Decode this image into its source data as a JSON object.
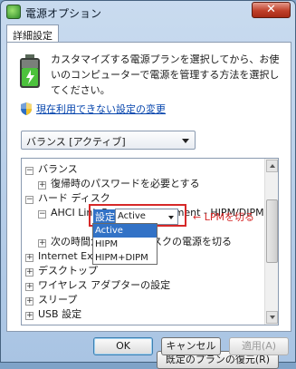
{
  "window": {
    "title": "電源オプション",
    "close_glyph": "✕"
  },
  "tabs": [
    {
      "label": "詳細設定"
    }
  ],
  "description": "カスタマイズする電源プランを選択してから、お使いのコンピューターで電源を管理する方法を選択してください。",
  "link_text": "現在利用できない設定の変更",
  "plan_select": {
    "value": "バランス [アクティブ]"
  },
  "tree": {
    "balance": "バランス",
    "wake_password": "復帰時のパスワードを必要とする",
    "hard_disk": "ハード ディスク",
    "ahci": "AHCI Link Power Management - HIPM/DIPM",
    "setting_label": "設定:",
    "setting_value": "Active",
    "next_time": "次の時間が",
    "next_time_tail": "ィスクの電源を切る",
    "internet": "Internet Exp",
    "desktop": "デスクトップ",
    "wireless": "ワイヤレス アダプターの設定",
    "sleep": "スリープ",
    "usb": "USB 設定"
  },
  "dropdown_options": [
    "Active",
    "HIPM",
    "HIPM+DIPM"
  ],
  "annotation": "← LPMを切る",
  "buttons": {
    "restore": "既定のプランの復元(R)",
    "ok": "OK",
    "cancel": "キャンセル",
    "apply": "適用(A)"
  },
  "colors": {
    "annotation": "#d62828",
    "selection": "#3272c6"
  }
}
